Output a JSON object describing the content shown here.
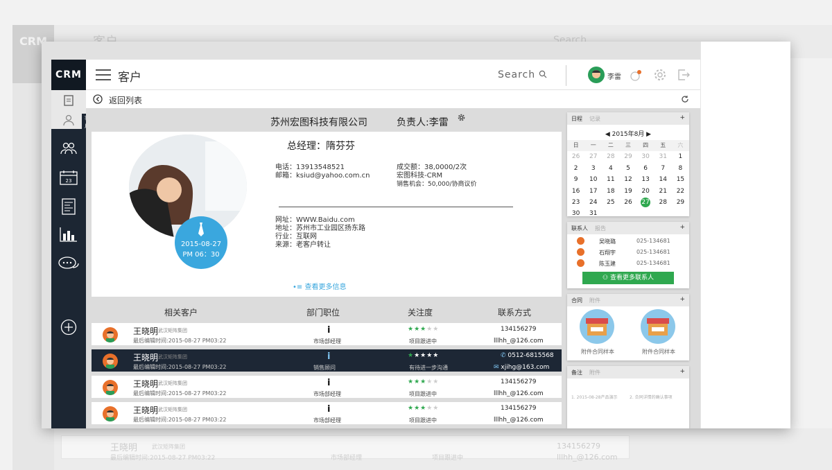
{
  "app": {
    "logo": "CRM",
    "page_title": "客户",
    "search_label": "Search",
    "username": "李雷"
  },
  "nav": {
    "back_label": "返回列表",
    "tooltip": "客户"
  },
  "customer": {
    "company": "苏州宏图科技有限公司",
    "owner": "负责人:李雷",
    "manager": "总经理：隋芬芬",
    "phone": "电话：13913548521",
    "email": "邮箱：ksiud@yahoo.com.cn",
    "deal": "成交额：38,0000/2次",
    "product": "宏图科技-CRM",
    "opportunity": "销售机会：50,000/协商议价",
    "website": "网址：WWW.Baidu.com",
    "address": "地址：苏州市工业园区扬东路",
    "industry": "行业：互联网",
    "source": "来源：老客户转让",
    "date": "2015-08-27",
    "time": "PM 06：30",
    "more_info": "查看更多信息"
  },
  "table": {
    "headers": [
      "相关客户",
      "部门职位",
      "关注度",
      "联系方式"
    ],
    "rows": [
      {
        "name": "王晓明",
        "company": "武汉矩阵集团",
        "time": "最后编辑时间:2015-08-27 PM03:22",
        "position": "市场部经理",
        "status": "项目跟进中",
        "phone": "134156279",
        "email": "lllhh_@126.com",
        "stars": 3
      },
      {
        "name": "王晓明",
        "company": "武汉矩阵集团",
        "time": "最后编辑时间:2015-08-27 PM03:22",
        "position": "销售顾问",
        "status": "有待进一步沟通",
        "phone": "0512-6815568",
        "email": "xjihg@163.com",
        "stars": 4
      },
      {
        "name": "王晓明",
        "company": "武汉矩阵集团",
        "time": "最后编辑时间:2015-08-27 PM03:22",
        "position": "市场部经理",
        "status": "项目跟进中",
        "phone": "134156279",
        "email": "lllhh_@126.com",
        "stars": 3
      },
      {
        "name": "王晓明",
        "company": "武汉矩阵集团",
        "time": "最后编辑时间:2015-08-27 PM03:22",
        "position": "市场部经理",
        "status": "项目跟进中",
        "phone": "134156279",
        "email": "lllhh_@126.com",
        "stars": 3
      }
    ]
  },
  "calendar": {
    "label": "日程",
    "sub": "记录",
    "month": "2015年8月",
    "weekdays": [
      "日",
      "一",
      "二",
      "三",
      "四",
      "五",
      "六"
    ],
    "weeks": [
      [
        "26",
        "27",
        "28",
        "29",
        "30",
        "31",
        "1"
      ],
      [
        "2",
        "3",
        "4",
        "5",
        "6",
        "7",
        "8"
      ],
      [
        "9",
        "10",
        "11",
        "12",
        "13",
        "14",
        "15"
      ],
      [
        "16",
        "17",
        "18",
        "19",
        "20",
        "21",
        "22"
      ],
      [
        "23",
        "24",
        "25",
        "26",
        "27",
        "28",
        "29"
      ],
      [
        "30",
        "31",
        "",
        "",
        "",
        "",
        ""
      ]
    ],
    "today": "27"
  },
  "contacts": {
    "label": "联系人",
    "sub": "报告",
    "items": [
      {
        "name": "吴晓璐",
        "phone": "025-134681"
      },
      {
        "name": "石翔宇",
        "phone": "025-134681"
      },
      {
        "name": "陈玉建",
        "phone": "025-134681"
      }
    ],
    "more_label": "查看更多联系人"
  },
  "contract": {
    "label": "合同",
    "sub": "附件",
    "items": [
      "附件合同样本",
      "附件合同样本"
    ]
  },
  "notes": {
    "label": "备注",
    "sub": "附件",
    "items": [
      "1. 2015-08-28产品演示",
      "2. 合同详情的确认事项"
    ]
  },
  "ghost": {
    "logo": "CRM",
    "title": "客户",
    "search": "Search",
    "name": "王晓明",
    "company": "武汉矩阵集团",
    "time": "最后编辑时间:2015-08-27 PM03:22",
    "position": "市场部经理",
    "status": "项目跟进中",
    "phone": "134156279",
    "email": "lllhh_@126.com"
  },
  "colors": {
    "sidebar": "#1c2633",
    "accent_blue": "#3aa7de",
    "accent_green": "#2fa84f",
    "avatar_orange": "#e8702a"
  }
}
